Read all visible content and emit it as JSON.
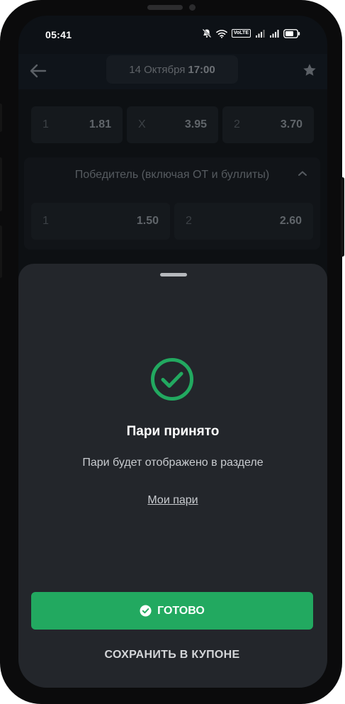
{
  "status_bar": {
    "time": "05:41",
    "icons": [
      "mute-bell-icon",
      "wifi-icon",
      "volte-icon",
      "signal-icon",
      "signal-icon",
      "battery-icon"
    ],
    "volte_text": "VoLTE"
  },
  "header": {
    "date": "14 Октября",
    "time": "17:00",
    "back_icon": "arrow-left-icon",
    "favorite_icon": "star-icon"
  },
  "background_markets": {
    "row1": [
      {
        "outcome": "1",
        "odds": "1.81"
      },
      {
        "outcome": "X",
        "odds": "3.95"
      },
      {
        "outcome": "2",
        "odds": "3.70"
      }
    ],
    "market_title": "Победитель (включая ОТ и буллиты)",
    "row2": [
      {
        "outcome": "1",
        "odds": "1.50"
      },
      {
        "outcome": "2",
        "odds": "2.60"
      }
    ]
  },
  "sheet": {
    "title": "Пари принято",
    "subtitle": "Пари будет отображено в разделе",
    "link": "Мои пари",
    "done_label": "ГОТОВО",
    "save_label": "СОХРАНИТЬ В КУПОНЕ"
  },
  "colors": {
    "accent_green": "#22a960",
    "sheet_bg": "#23262b"
  }
}
